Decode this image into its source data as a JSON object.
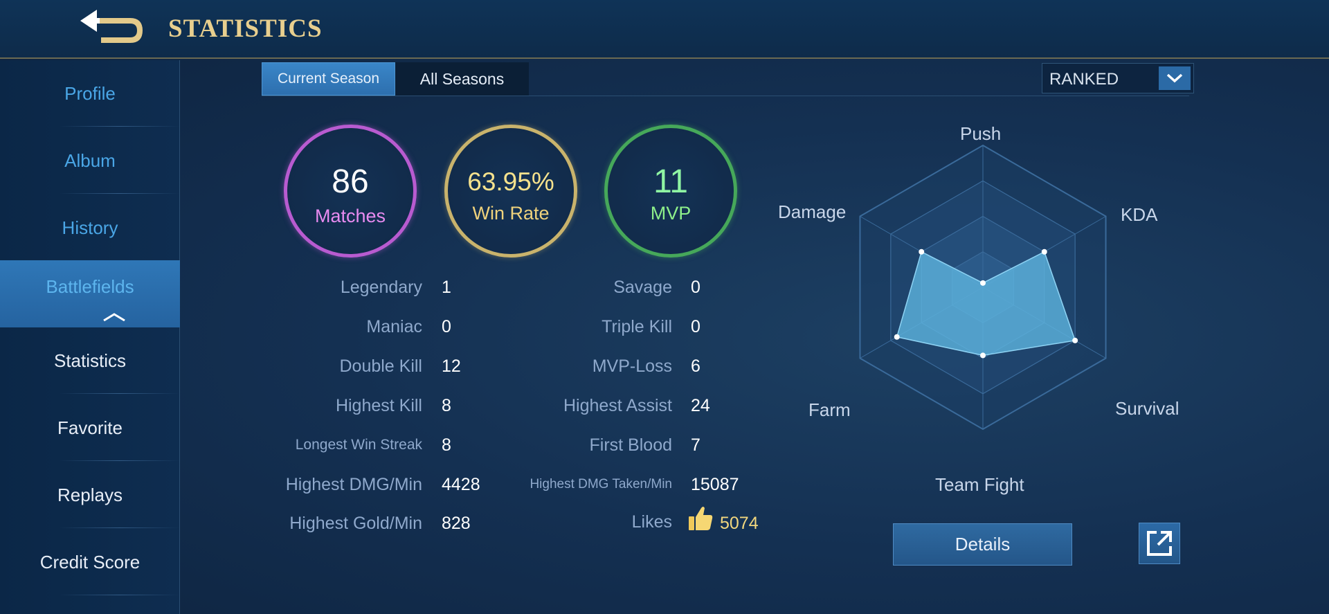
{
  "header": {
    "title": "STATISTICS"
  },
  "sidebar": {
    "items": [
      {
        "label": "Profile"
      },
      {
        "label": "Album"
      },
      {
        "label": "History"
      },
      {
        "label": "Battlefields"
      },
      {
        "label": "Statistics"
      },
      {
        "label": "Favorite"
      },
      {
        "label": "Replays"
      },
      {
        "label": "Credit Score"
      }
    ]
  },
  "tabs": {
    "current": "Current Season",
    "all": "All Seasons"
  },
  "mode": {
    "selected": "RANKED"
  },
  "summary": {
    "matches": {
      "value": "86",
      "label": "Matches"
    },
    "win_rate": {
      "value": "63.95%",
      "label": "Win Rate"
    },
    "mvp": {
      "value": "11",
      "label": "MVP"
    }
  },
  "stats": {
    "left": [
      {
        "label": "Legendary",
        "value": "1"
      },
      {
        "label": "Maniac",
        "value": "0"
      },
      {
        "label": "Double Kill",
        "value": "12"
      },
      {
        "label": "Highest Kill",
        "value": "8"
      },
      {
        "label": "Longest Win Streak",
        "value": "8"
      },
      {
        "label": "Highest DMG/Min",
        "value": "4428"
      },
      {
        "label": "Highest Gold/Min",
        "value": "828"
      }
    ],
    "right": [
      {
        "label": "Savage",
        "value": "0"
      },
      {
        "label": "Triple Kill",
        "value": "0"
      },
      {
        "label": "MVP-Loss",
        "value": "6"
      },
      {
        "label": "Highest Assist",
        "value": "24"
      },
      {
        "label": "First Blood",
        "value": "7"
      },
      {
        "label": "Highest DMG Taken/Min",
        "value": "15087"
      },
      {
        "label": "Likes",
        "value": "5074"
      }
    ]
  },
  "radar": {
    "labels": {
      "push": "Push",
      "kda": "KDA",
      "survival": "Survival",
      "team_fight": "Team Fight",
      "farm": "Farm",
      "damage": "Damage"
    },
    "values": {
      "push": 0.03,
      "kda": 0.5,
      "survival": 0.75,
      "team_fight": 0.48,
      "farm": 0.7,
      "damage": 0.5
    },
    "colors": {
      "fill": "#5fb6e0",
      "grid": "#3a6a9a"
    }
  },
  "buttons": {
    "details": "Details"
  },
  "icons": {
    "back": "back-arrow-icon",
    "dropdown": "chevron-down-icon",
    "collapse": "chevron-up-icon",
    "like": "thumbs-up-icon",
    "share": "share-external-icon"
  }
}
